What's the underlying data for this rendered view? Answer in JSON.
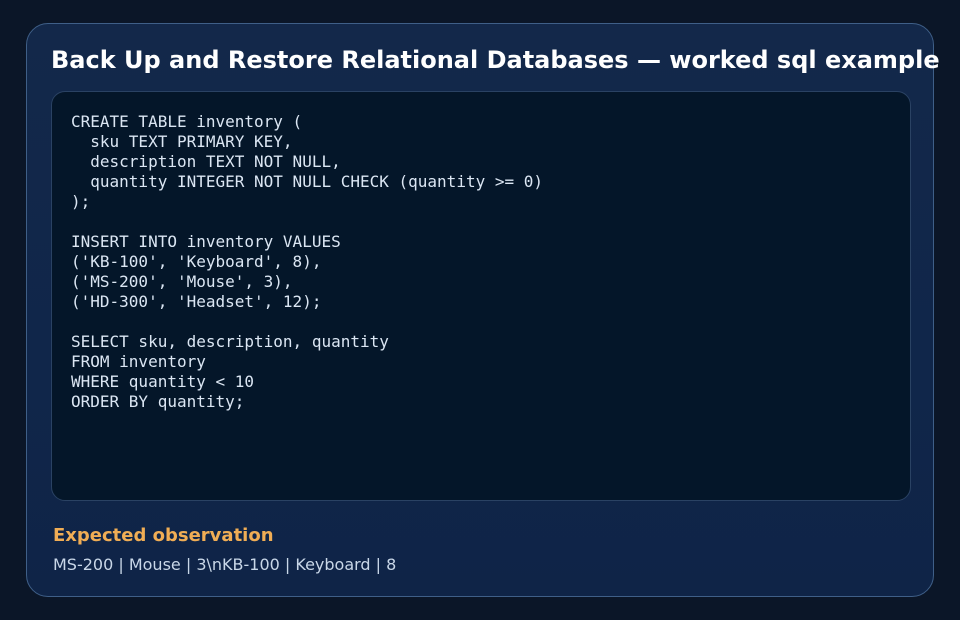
{
  "card": {
    "title": "Back Up and Restore Relational Databases — worked sql example",
    "code": "CREATE TABLE inventory (\n  sku TEXT PRIMARY KEY,\n  description TEXT NOT NULL,\n  quantity INTEGER NOT NULL CHECK (quantity >= 0)\n);\n\nINSERT INTO inventory VALUES\n('KB-100', 'Keyboard', 8),\n('MS-200', 'Mouse', 3),\n('HD-300', 'Headset', 12);\n\nSELECT sku, description, quantity\nFROM inventory\nWHERE quantity < 10\nORDER BY quantity;",
    "observation_heading": "Expected observation",
    "observation_value": "MS-200 | Mouse | 3\\nKB-100 | Keyboard | 8"
  },
  "colors": {
    "background": "#0b1628",
    "card": "#12284a",
    "code_panel": "#041629",
    "title": "#ffffff",
    "accent": "#f0ad55",
    "body_text": "#c9d7e8"
  }
}
